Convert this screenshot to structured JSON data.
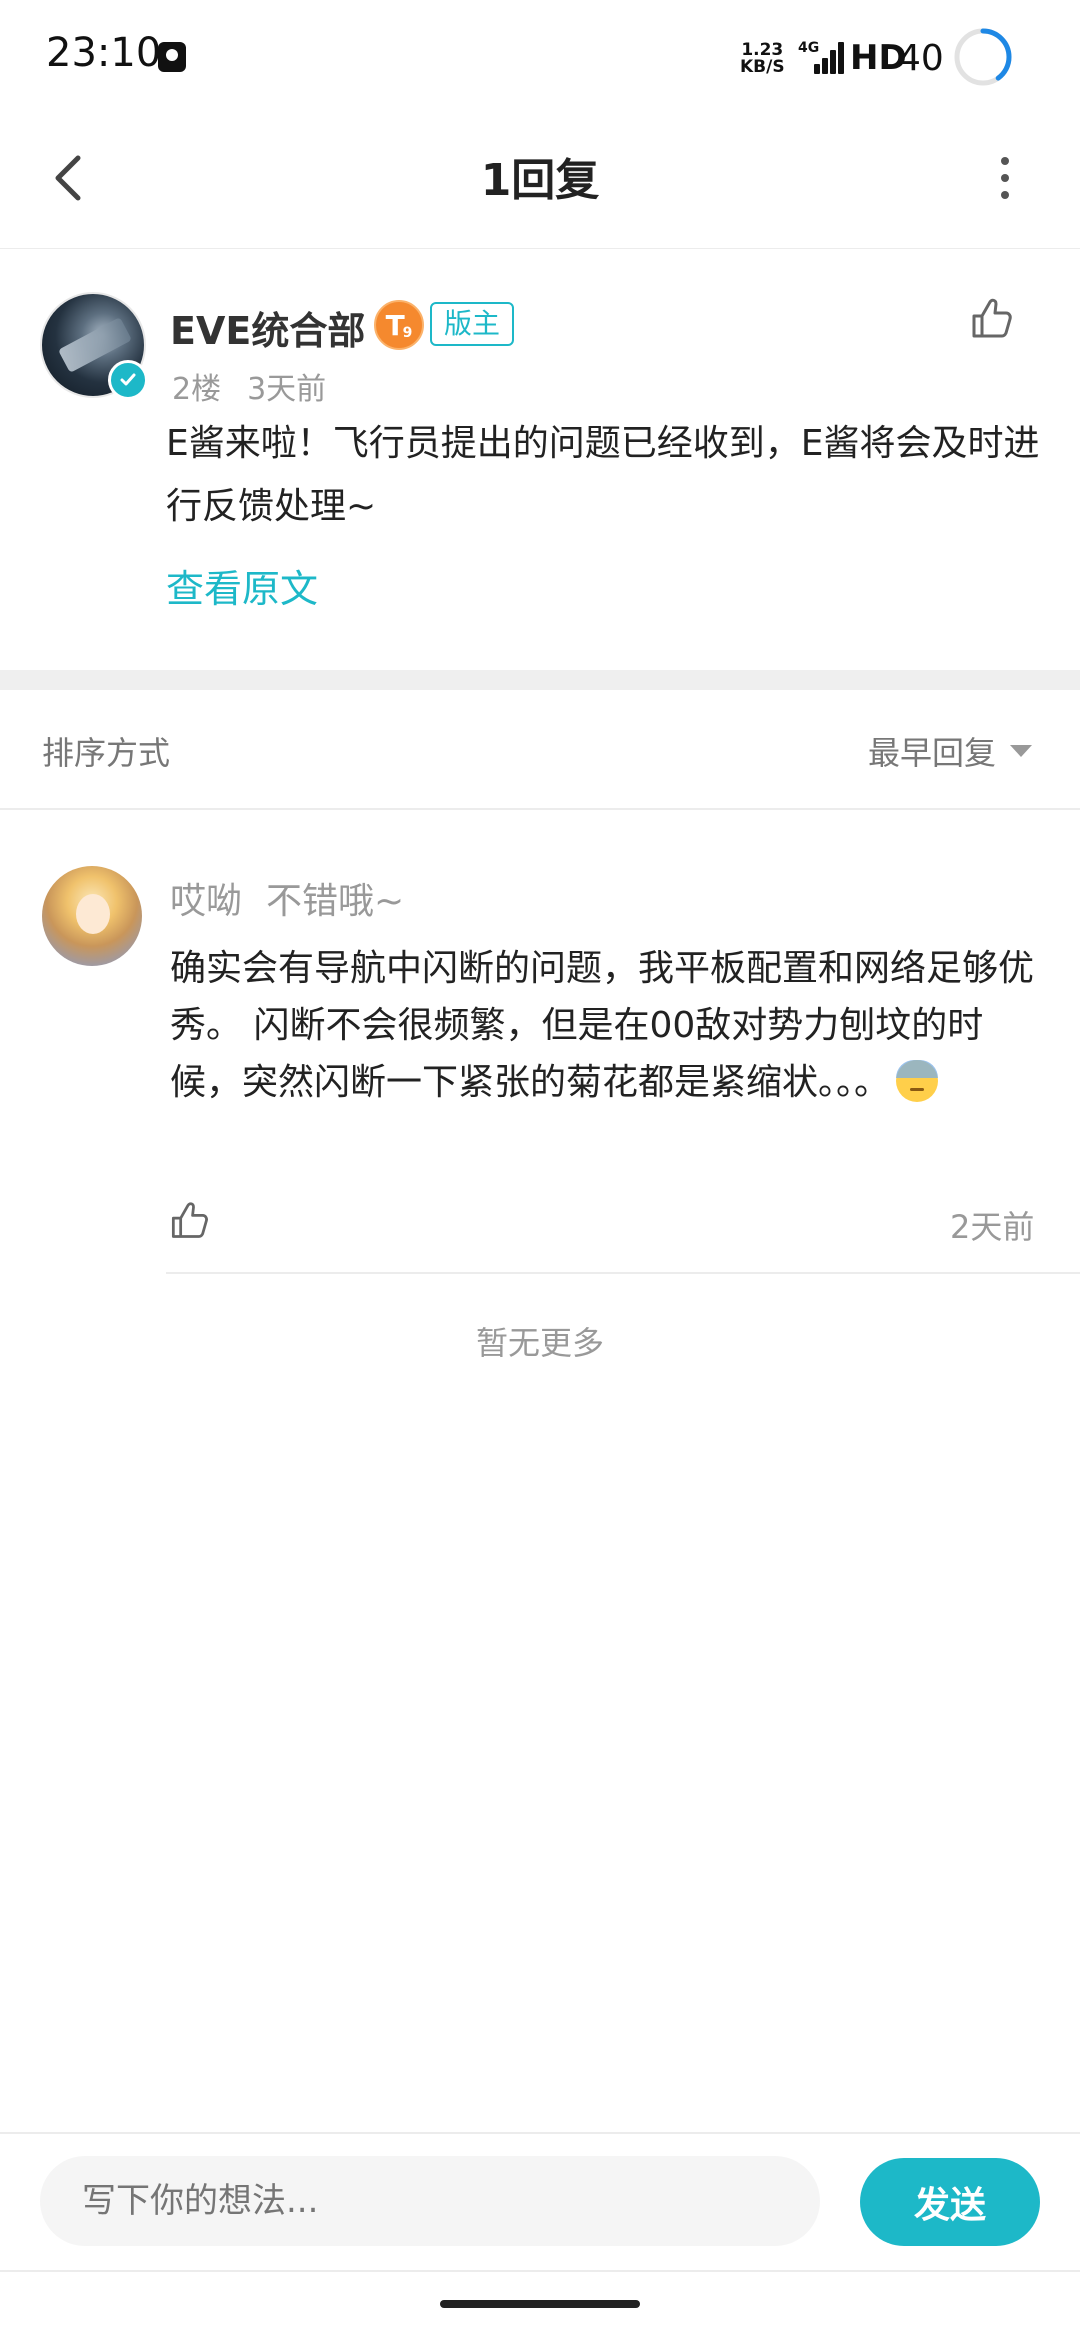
{
  "status_bar": {
    "time": "23:10",
    "net_speed_top": "1.23",
    "net_speed_bottom": "KB/S",
    "network": "4G",
    "hd": "HD",
    "battery": "40",
    "battery_level": 0.4,
    "notification_icon": "notification-icon"
  },
  "header": {
    "title": "1回复",
    "back_icon": "chevron-left-icon",
    "more_icon": "more-vertical-icon"
  },
  "post": {
    "author": "EVE统合部",
    "level_badge": "T",
    "level_sub": "9",
    "role_badge": "版主",
    "floor": "2楼",
    "time": "3天前",
    "content": "E酱来啦！飞行员提出的问题已经收到，E酱将会及时进行反馈处理~",
    "view_original": "查看原文"
  },
  "sort": {
    "label": "排序方式",
    "selected": "最早回复"
  },
  "reply": {
    "user": "哎呦",
    "user_note": "不错哦~",
    "content": "确实会有导航中闪断的问题，我平板配置和网络足够优秀。 闪断不会很频繁，但是在00敌对势力刨坟的时候，突然闪断一下紧张的菊花都是紧缩状。。。",
    "emoji": "sweat-emoji",
    "time": "2天前"
  },
  "no_more": "暂无更多",
  "composer": {
    "placeholder": "写下你的想法...",
    "send_label": "发送"
  },
  "colors": {
    "accent": "#1db8c8",
    "level_badge": "#f5892e",
    "text_primary": "#222222",
    "text_secondary": "#999999"
  }
}
